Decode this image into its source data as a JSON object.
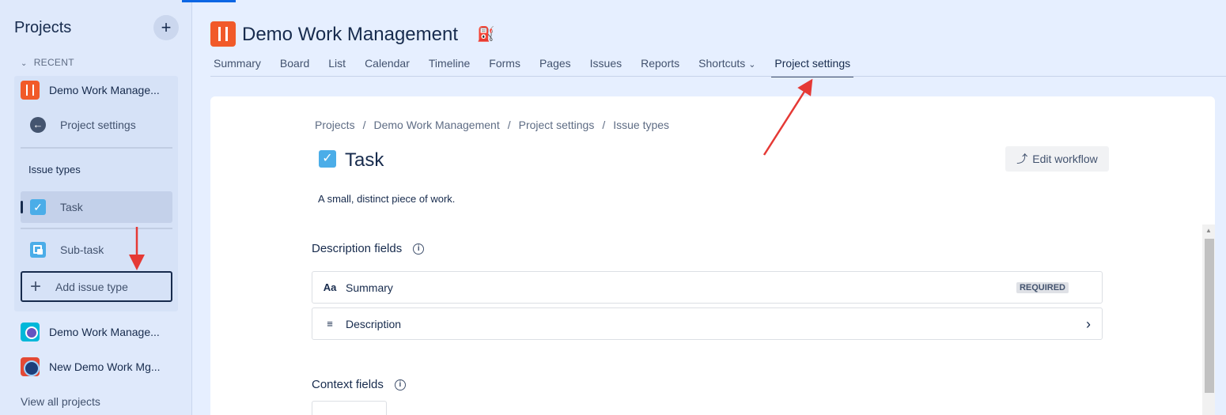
{
  "sidebar": {
    "title": "Projects",
    "add_icon": "plus-icon",
    "recent_label": "RECENT",
    "current_project": "Demo Work Manage...",
    "back_label": "Project settings",
    "section_label": "Issue types",
    "issue_types": [
      {
        "label": "Task",
        "icon": "task-checkbox-icon",
        "active": true
      },
      {
        "label": "Sub-task",
        "icon": "subtask-icon",
        "active": false
      }
    ],
    "add_issue_type": "Add issue type",
    "other_projects": [
      {
        "label": "Demo Work Manage...",
        "icon": "project-robot-icon"
      },
      {
        "label": "New Demo Work Mg...",
        "icon": "project-globe-icon"
      }
    ],
    "view_all": "View all projects"
  },
  "header": {
    "title": "Demo Work Management",
    "paint_icon": "paint-bucket-icon",
    "tabs": [
      {
        "label": "Summary"
      },
      {
        "label": "Board"
      },
      {
        "label": "List"
      },
      {
        "label": "Calendar"
      },
      {
        "label": "Timeline"
      },
      {
        "label": "Forms"
      },
      {
        "label": "Pages"
      },
      {
        "label": "Issues"
      },
      {
        "label": "Reports"
      },
      {
        "label": "Shortcuts"
      },
      {
        "label": "Project settings",
        "active": true
      }
    ]
  },
  "main": {
    "breadcrumb": [
      "Projects",
      "Demo Work Management",
      "Project settings",
      "Issue types"
    ],
    "breadcrumb_separator": "/",
    "title": "Task",
    "edit_workflow": "Edit workflow",
    "description": "A small, distinct piece of work.",
    "description_fields_title": "Description fields",
    "fields": [
      {
        "icon_text": "Aa",
        "label": "Summary",
        "badge": "REQUIRED"
      },
      {
        "icon_text": "≡",
        "label": "Description"
      }
    ],
    "context_fields_title": "Context fields"
  },
  "colors": {
    "accent": "#0c66e4",
    "sidebar_bg": "#dfe9fb",
    "project_icon": "#f15a29",
    "task_icon": "#4bade8",
    "annotation_arrow": "#e53935"
  }
}
